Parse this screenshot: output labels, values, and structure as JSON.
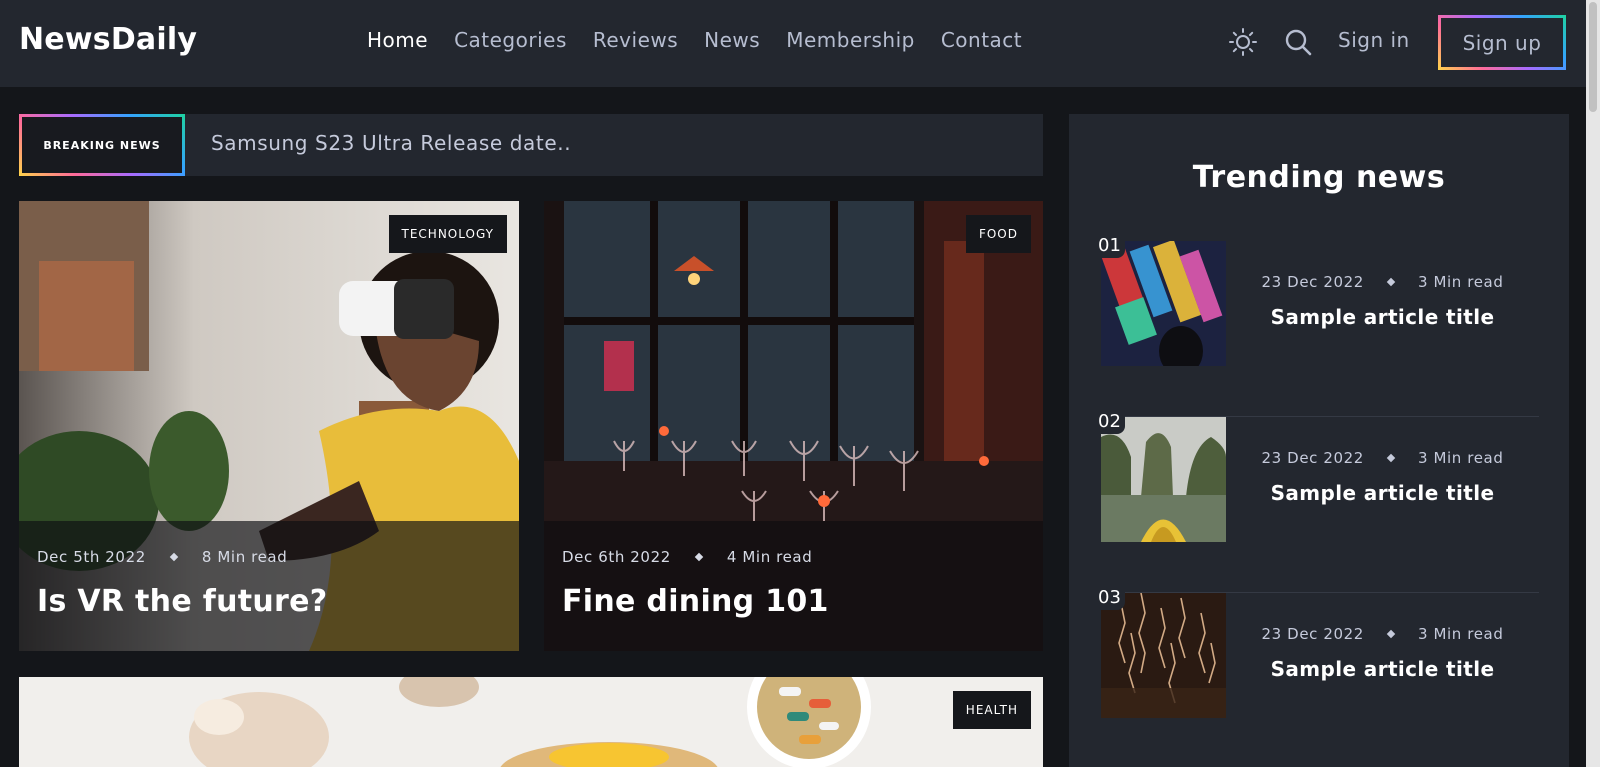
{
  "header": {
    "logo": "NewsDaily",
    "nav": [
      "Home",
      "Categories",
      "Reviews",
      "News",
      "Membership",
      "Contact"
    ],
    "active_nav": "Home",
    "theme_icon": "sun-icon",
    "search_icon": "search-icon",
    "signin_label": "Sign in",
    "signup_label": "Sign up"
  },
  "breaking": {
    "label": "BREAKING NEWS",
    "headline": "Samsung S23 Ultra Release date.."
  },
  "cards": [
    {
      "category": "TECHNOLOGY",
      "date": "Dec 5th 2022",
      "read_time": "8 Min read",
      "title": "Is VR the future?"
    },
    {
      "category": "FOOD",
      "date": "Dec 6th 2022",
      "read_time": "4 Min read",
      "title": "Fine dining 101"
    },
    {
      "category": "HEALTH"
    }
  ],
  "sidebar": {
    "title": "Trending news",
    "items": [
      {
        "num": "01",
        "date": "23 Dec 2022",
        "read_time": "3 Min read",
        "title": "Sample article title"
      },
      {
        "num": "02",
        "date": "23 Dec 2022",
        "read_time": "3 Min read",
        "title": "Sample article title"
      },
      {
        "num": "03",
        "date": "23 Dec 2022",
        "read_time": "3 Min read",
        "title": "Sample article title"
      }
    ]
  },
  "colors": {
    "header_bg": "#23272f",
    "page_bg": "#14161a",
    "gradient": [
      "#ffd54a",
      "#ff6b9a",
      "#a86bff",
      "#35a3ff",
      "#1ed3a0"
    ]
  }
}
